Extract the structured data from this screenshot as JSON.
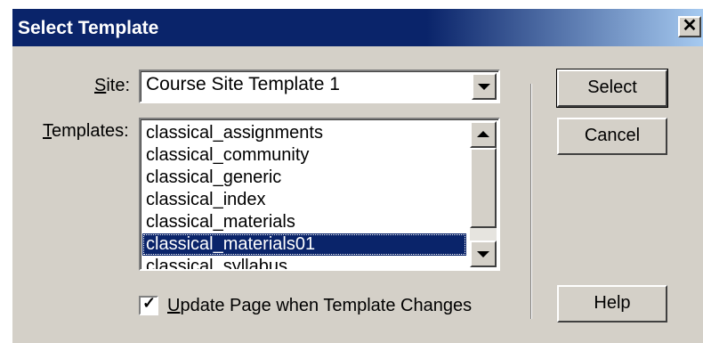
{
  "window": {
    "title": "Select Template",
    "close_glyph": "✕"
  },
  "site": {
    "label_underlined": "S",
    "label_rest": "ite:",
    "value": "Course Site Template 1"
  },
  "templates": {
    "label_underlined": "T",
    "label_rest": "emplates:",
    "items": [
      "classical_assignments",
      "classical_community",
      "classical_generic",
      "classical_index",
      "classical_materials",
      "classical_materials01",
      "classical_syllabus"
    ],
    "selected": "classical_materials01"
  },
  "checkbox": {
    "checked": true,
    "label_underlined": "U",
    "label_rest": "pdate Page when Template Changes"
  },
  "buttons": {
    "select": "Select",
    "cancel": "Cancel",
    "help": "Help"
  },
  "icons": {
    "dropdown": "chevron-down-icon",
    "scroll_up": "scroll-up-icon",
    "scroll_down": "scroll-down-icon",
    "check": "checkmark-icon"
  }
}
